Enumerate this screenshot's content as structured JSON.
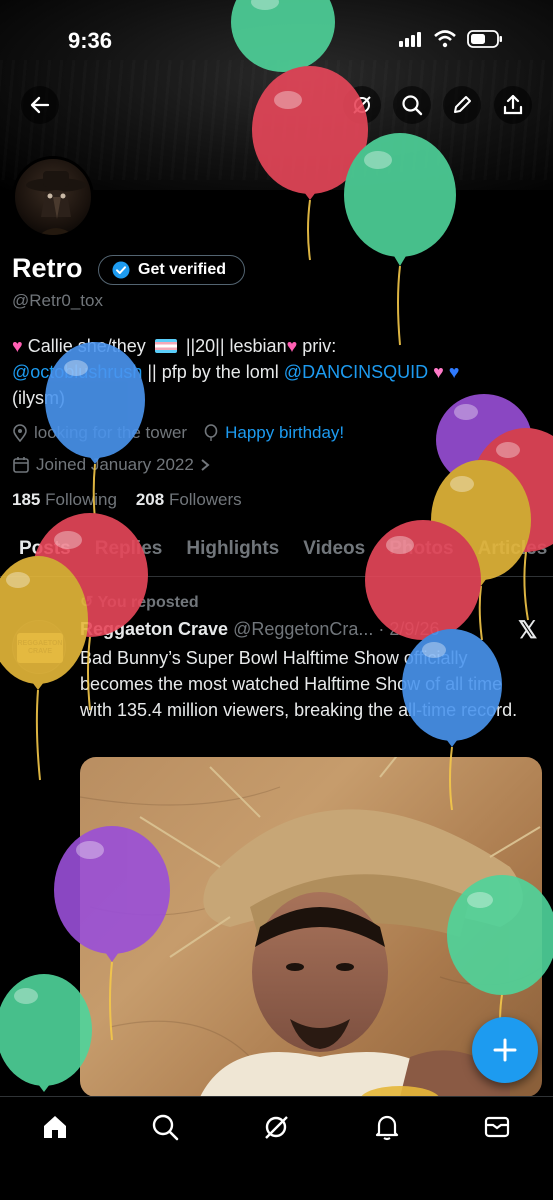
{
  "status_bar": {
    "time": "9:36"
  },
  "header": {
    "back_icon": "arrow-left-icon",
    "actions": [
      "grok-icon",
      "search-icon",
      "pen-icon",
      "share-icon"
    ]
  },
  "profile": {
    "name": "Retro",
    "verify_label": "Get verified",
    "handle": "@Retr0_tox",
    "bio_line1": "Callie she/they",
    "bio_line1b": "||20|| lesbian",
    "bio_line1c": "priv:",
    "bio_mention1": "@octoblushrush",
    "bio_line2": "|| pfp by the loml",
    "bio_mention2": "@DANCINSQUID",
    "bio_line3": "(ilysm)",
    "location": "looking for the tower",
    "birthday": "Happy birthday!",
    "joined": "Joined January 2022",
    "following_count": "185",
    "following_label": "Following",
    "followers_count": "208",
    "followers_label": "Followers"
  },
  "tabs": [
    "Posts",
    "Replies",
    "Highlights",
    "Videos",
    "Photos",
    "Articles"
  ],
  "post": {
    "repost_label": "You reposted",
    "author": "Reggaeton Crave",
    "author_handle": "@ReggetonCra...",
    "date": "2/9/26",
    "text": "Bad Bunny’s Super Bowl Halftime Show officially becomes the most watched Halftime Show of all time with 135.4 million viewers, breaking the all-time record.",
    "avatar_text": "REGGAETON CRAVE"
  },
  "fab_label": "+",
  "colors": {
    "accent": "#1d9bf0",
    "background": "#000000",
    "muted": "#71767b"
  }
}
